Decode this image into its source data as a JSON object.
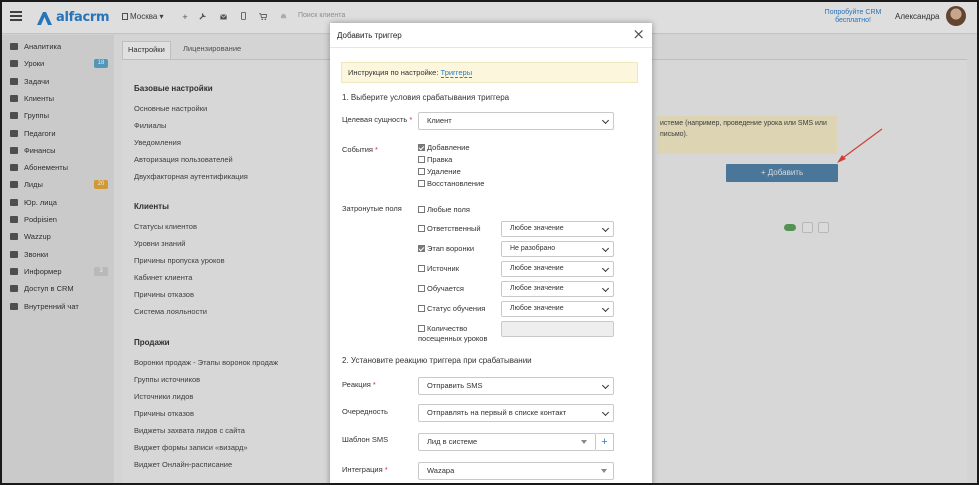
{
  "topbar": {
    "brand": "alfacrm",
    "branch": "Москва",
    "branch_caret": "▾",
    "search_placeholder": "Поиск клиента",
    "promo": "Попробуйте CRM бесплатно!",
    "user_name": "Александра",
    "icons": [
      "plus-icon",
      "wrench-icon",
      "envelope-icon",
      "mobile-icon",
      "cart-icon",
      "bell-icon"
    ],
    "accent": "#2a7ec9"
  },
  "sidebar": {
    "items": [
      {
        "label": "Аналитика",
        "icon": "chart-icon"
      },
      {
        "label": "Уроки",
        "icon": "calendar-icon",
        "badge": "18",
        "badge_color": "#5ba3c9"
      },
      {
        "label": "Задачи",
        "icon": "tasks-icon"
      },
      {
        "label": "Клиенты",
        "icon": "user-icon"
      },
      {
        "label": "Группы",
        "icon": "users-icon"
      },
      {
        "label": "Педагоги",
        "icon": "teacher-icon"
      },
      {
        "label": "Финансы",
        "icon": "money-icon"
      },
      {
        "label": "Абонементы",
        "icon": "tag-icon"
      },
      {
        "label": "Лиды",
        "icon": "lead-icon",
        "badge": "20",
        "badge_color": "#e2a63b"
      },
      {
        "label": "Юр. лица",
        "icon": "building-icon"
      },
      {
        "label": "Podpisien",
        "icon": "doc-icon"
      },
      {
        "label": "Wazzup",
        "icon": "chat-icon"
      },
      {
        "label": "Звонки",
        "icon": "phone-icon"
      },
      {
        "label": "Информер",
        "icon": "informer-icon",
        "badge": "3",
        "badge_color": "#c9c9c9"
      },
      {
        "label": "Доступ в CRM",
        "icon": "lock-icon"
      },
      {
        "label": "Внутренний чат",
        "icon": "message-icon"
      }
    ]
  },
  "main": {
    "tabs": [
      "Настройки",
      "Лицензирование"
    ],
    "sections": [
      {
        "title": "Базовые настройки",
        "links": [
          "Основные настройки",
          "Филиалы",
          "Уведомления",
          "Авторизация пользователей",
          "Двухфакторная аутентификация"
        ]
      },
      {
        "title": "Клиенты",
        "links": [
          "Статусы клиентов",
          "Уровни знаний",
          "Причины пропуска уроков",
          "Кабинет клиента",
          "Причины отказов",
          "Система лояльности"
        ]
      },
      {
        "title": "Продажи",
        "links": [
          "Воронки продаж - Этапы воронок продаж",
          "Группы источников",
          "Источники лидов",
          "Причины отказов",
          "Виджеты захвата лидов с сайта",
          "Виджет формы записи «визард»",
          "Виджет Онлайн-расписание"
        ]
      }
    ],
    "alert_text": "истеме (например, проведение урока или SMS или письмо).",
    "add_button": "+ Добавить"
  },
  "modal": {
    "title": "Добавить триггер",
    "close": "×",
    "instruction_text": "Инструкция по настройке:",
    "instruction_link": "Триггеры",
    "step1": "1. Выберите условия срабатывания триггера",
    "entity_label": "Целевая сущность",
    "entity_value": "Клиент",
    "events_label": "События",
    "events": [
      {
        "label": "Добавление",
        "checked": true
      },
      {
        "label": "Правка",
        "checked": false
      },
      {
        "label": "Удаление",
        "checked": false
      },
      {
        "label": "Восстановление",
        "checked": false
      }
    ],
    "fields_label": "Затронутые поля",
    "any_fields": "Любые поля",
    "fields": [
      {
        "label": "Ответственный",
        "checked": false,
        "value": "Любое значение"
      },
      {
        "label": "Этап воронки",
        "checked": true,
        "value": "Не разобрано"
      },
      {
        "label": "Источник",
        "checked": false,
        "value": "Любое значение"
      },
      {
        "label": "Обучается",
        "checked": false,
        "value": "Любое значение"
      },
      {
        "label": "Статус обучения",
        "checked": false,
        "value": "Любое значение"
      },
      {
        "label": "Количество",
        "label2": "посещенных уроков",
        "checked": false,
        "value": ""
      }
    ],
    "step2": "2. Установите реакцию триггера при срабатывании",
    "reaction_label": "Реакция",
    "reaction_value": "Отправить SMS",
    "queue_label": "Очередность",
    "queue_value": "Отправлять на первый в списке контакт",
    "template_label": "Шаблон SMS",
    "template_value": "Лид в системе",
    "template_add": "+",
    "integration_label": "Интеграция",
    "integration_value": "Wazapa",
    "required_mark": "*"
  }
}
